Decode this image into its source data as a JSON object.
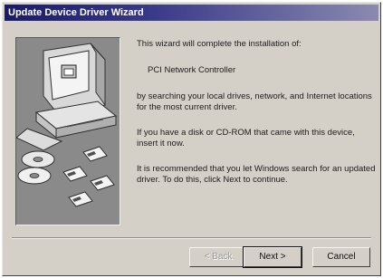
{
  "window": {
    "title": "Update Device Driver Wizard"
  },
  "content": {
    "intro": "This wizard will complete the installation of:",
    "device_name": "PCI Network Controller",
    "search_text": "by searching your local drives, network, and Internet locations for the most current driver.",
    "disk_text": "If you have a disk or CD-ROM that came with this device, insert it now.",
    "recommend_text": "It is recommended that you let Windows search for an updated driver. To do this, click Next to continue."
  },
  "buttons": {
    "back": "< Back",
    "next": "Next >",
    "cancel": "Cancel"
  },
  "illustration": {
    "icons": [
      "computer-icon",
      "cd-rom-icon",
      "floppy-disk-icon"
    ],
    "colors": {
      "panel": "#8a8a8a",
      "monitor": "#e0e0e0",
      "titlebar": "#1a1a6a"
    }
  }
}
